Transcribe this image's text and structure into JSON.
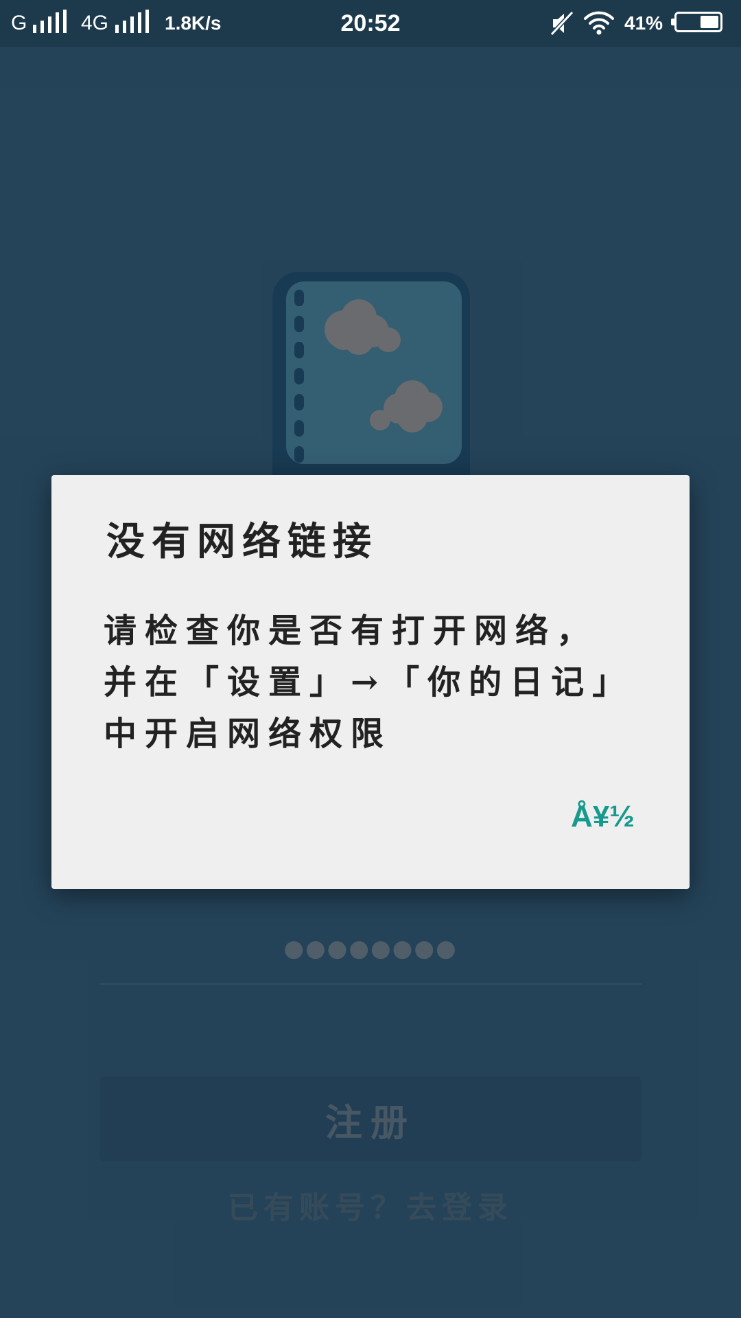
{
  "status_bar": {
    "network_1": "G",
    "network_2": "4G",
    "speed": "1.8K/s",
    "time": "20:52",
    "battery": "41%",
    "battery_level": 0.41,
    "icons": [
      "signal-icon",
      "mute-icon",
      "wifi-icon",
      "battery-icon"
    ]
  },
  "app": {
    "logo_icon": "diary-cloud-logo-icon",
    "password_dots": "●●●●●●●●",
    "register_label": "注册",
    "login_link": "已有账号？去登录"
  },
  "dialog": {
    "title": "没有网络链接",
    "message": "请检查你是否有打开网络，并在「设置」→「你的日记」中开启网络权限",
    "ok_label": "Å¥½"
  },
  "colors": {
    "background": "#2f5c78",
    "status_bar": "#1d3a4c",
    "dialog_bg": "#efeff0",
    "accent": "#159a8d"
  }
}
